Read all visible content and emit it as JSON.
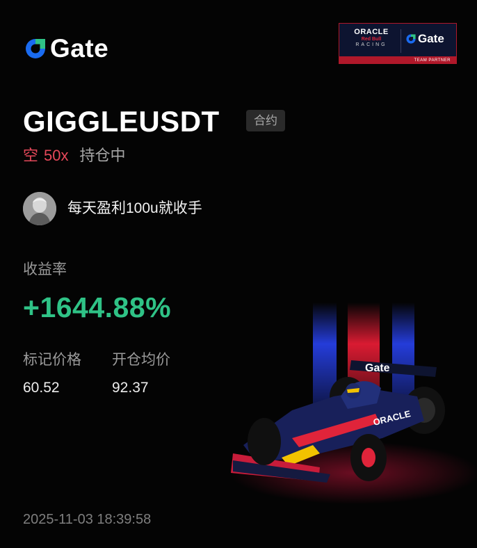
{
  "brand": {
    "name": "Gate",
    "accent": "#1a6bf0"
  },
  "partner_badge": {
    "oracle": "ORACLE",
    "redbull": "Red Bull",
    "racing": "RACING",
    "gate": "Gate",
    "strip": "TEAM PARTNER",
    "border_color": "#b0182a"
  },
  "position": {
    "symbol": "GIGGLEUSDT",
    "type_tag": "合约",
    "side": "空",
    "leverage": "50x",
    "status": "持仓中"
  },
  "user": {
    "name": "每天盈利100u就收手"
  },
  "roi": {
    "label": "收益率",
    "value": "+1644.88%",
    "color": "#2fc286"
  },
  "prices": {
    "mark_label": "标记价格",
    "mark_value": "60.52",
    "open_label": "开仓均价",
    "open_value": "92.37"
  },
  "timestamp": "2025-11-03 18:39:58",
  "colors": {
    "short": "#e5485a",
    "background": "#040404"
  }
}
